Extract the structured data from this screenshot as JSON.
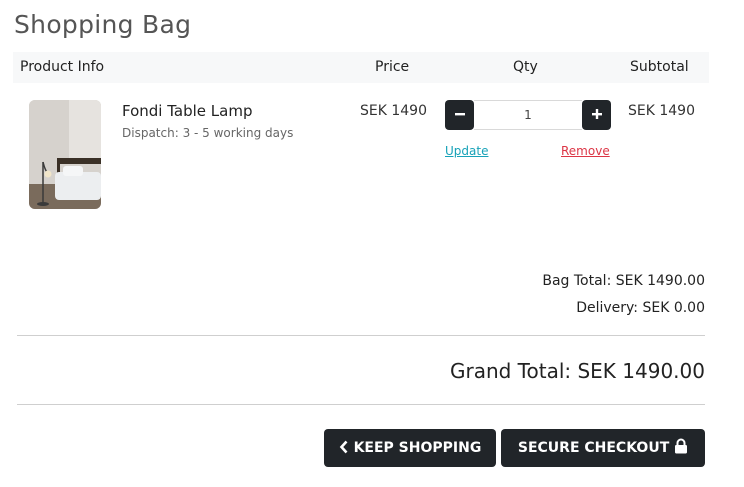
{
  "page": {
    "title": "Shopping Bag"
  },
  "table": {
    "headers": {
      "product": "Product Info",
      "price": "Price",
      "qty": "Qty",
      "subtotal": "Subtotal"
    }
  },
  "item": {
    "name": "Fondi Table Lamp",
    "dispatch": "Dispatch: 3 - 5 working days",
    "price": "SEK 1490",
    "quantity": "1",
    "update_label": "Update",
    "remove_label": "Remove",
    "subtotal": "SEK 1490"
  },
  "totals": {
    "bag_total": "Bag Total: SEK 1490.00",
    "delivery": "Delivery: SEK 0.00",
    "grand_total": "Grand Total: SEK 1490.00"
  },
  "actions": {
    "keep_shopping": "KEEP SHOPPING",
    "secure_checkout": "SECURE CHECKOUT"
  },
  "icons": {
    "minus": "minus-icon",
    "plus": "plus-icon",
    "keep_shopping": "chevron-left-icon",
    "checkout": "lock-icon"
  },
  "colors": {
    "button_dark": "#212529",
    "update_link": "#17a2b8",
    "remove_link": "#dc3545",
    "header_bg": "#f7f8f9"
  }
}
